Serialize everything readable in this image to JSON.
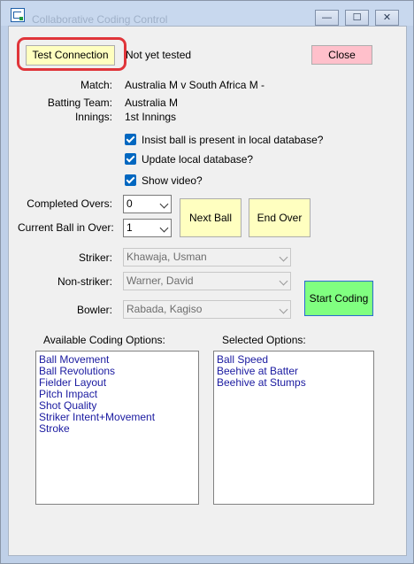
{
  "window": {
    "title": "Collaborative Coding Control",
    "controls": {
      "minimize": "—",
      "maximize": "☐",
      "close": "✕"
    }
  },
  "connection": {
    "test_button": "Test Connection",
    "status": "Not yet tested",
    "close_button": "Close"
  },
  "match": {
    "match_label": "Match:",
    "match_value": "Australia M v South Africa M -",
    "batting_label": "Batting Team:",
    "batting_value": "Australia M",
    "innings_label": "Innings:",
    "innings_value": "1st Innings"
  },
  "options": {
    "insist_label": "Insist ball is present in local database?",
    "update_label": "Update local database?",
    "video_label": "Show video?"
  },
  "overs": {
    "completed_label": "Completed Overs:",
    "completed_value": "0",
    "current_label": "Current Ball in Over:",
    "current_value": "1",
    "next_ball_button": "Next Ball",
    "end_over_button": "End Over"
  },
  "players": {
    "striker_label": "Striker:",
    "striker_value": "Khawaja, Usman",
    "nonstriker_label": "Non-striker:",
    "nonstriker_value": "Warner, David",
    "bowler_label": "Bowler:",
    "bowler_value": "Rabada, Kagiso",
    "start_coding_button": "Start Coding"
  },
  "lists": {
    "available_label": "Available Coding Options:",
    "available_items": [
      "Ball Movement",
      "Ball Revolutions",
      "Fielder Layout",
      "Pitch Impact",
      "Shot Quality",
      "Striker Intent+Movement",
      "Stroke"
    ],
    "selected_label": "Selected Options:",
    "selected_items": [
      "Ball Speed",
      "Beehive at Batter",
      "Beehive at Stumps"
    ]
  }
}
